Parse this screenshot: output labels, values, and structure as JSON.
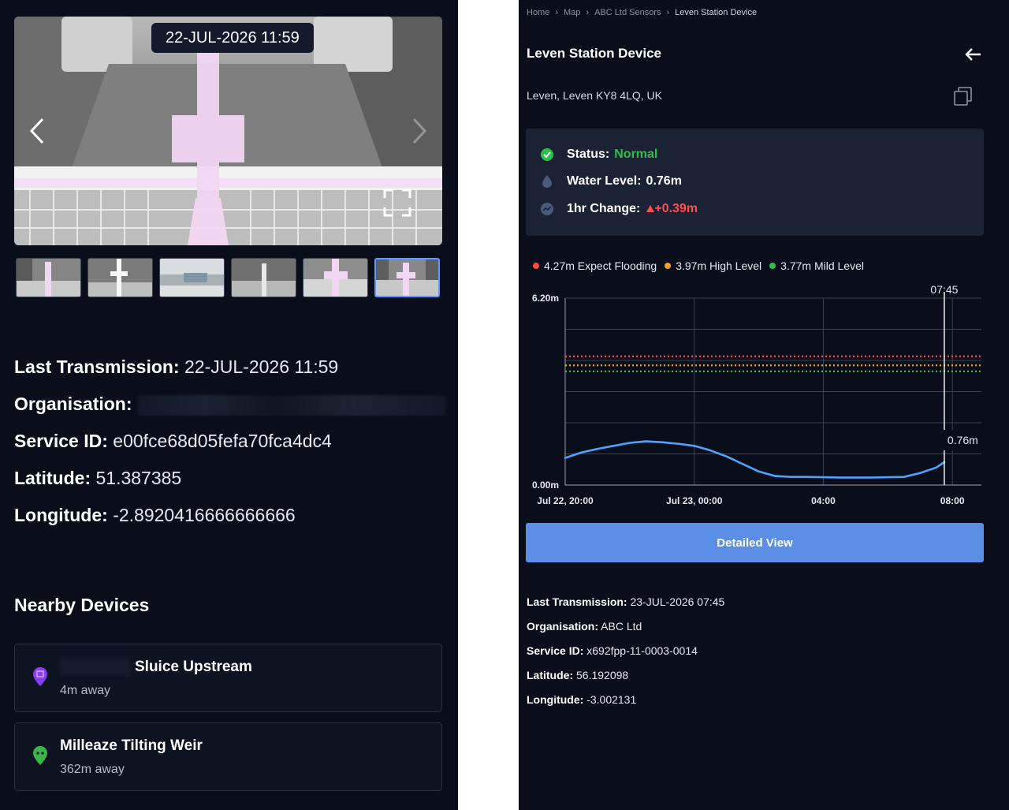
{
  "left": {
    "image_timestamp": "22-JUL-2026 11:59",
    "thumbnail_count": 6,
    "active_thumbnail": 6,
    "info": {
      "last_transmission_label": "Last Transmission:",
      "last_transmission_value": "22-JUL-2026 11:59",
      "organisation_label": "Organisation:",
      "service_id_label": "Service ID:",
      "service_id_value": "e00fce68d05fefa70fca4dc4",
      "latitude_label": "Latitude:",
      "latitude_value": "51.387385",
      "longitude_label": "Longitude:",
      "longitude_value": "-2.8920416666666666"
    },
    "nearby": {
      "title": "Nearby Devices",
      "devices": [
        {
          "name": "Sluice Upstream",
          "distance": "4m away",
          "pin_color": "#8a3cf0"
        },
        {
          "name": "Milleaze Tilting Weir",
          "distance": "362m away",
          "pin_color": "#39b54a"
        }
      ]
    }
  },
  "right": {
    "breadcrumb": [
      "Home",
      "Map",
      "ABC Ltd Sensors",
      "Leven Station Device"
    ],
    "title": "Leven Station Device",
    "address": "Leven, Leven KY8 4LQ, UK",
    "status": {
      "status_label": "Status:",
      "status_value": "Normal",
      "water_label": "Water Level:",
      "water_value": "0.76m",
      "change_label": "1hr Change:",
      "change_value": "+0.39m"
    },
    "legend": [
      {
        "label": "4.27m Expect Flooding",
        "color": "#ff4a4a"
      },
      {
        "label": "3.97m High Level",
        "color": "#f0a030"
      },
      {
        "label": "3.77m Mild Level",
        "color": "#2fbe4d"
      }
    ],
    "button_label": "Detailed View",
    "info": {
      "last_transmission_label": "Last Transmission:",
      "last_transmission_value": "23-JUL-2026 07:45",
      "organisation_label": "Organisation:",
      "organisation_value": "ABC Ltd",
      "service_id_label": "Service ID:",
      "service_id_value": "x692fpp-11-0003-0014",
      "latitude_label": "Latitude:",
      "latitude_value": "56.192098",
      "longitude_label": "Longitude:",
      "longitude_value": "-3.002131"
    }
  },
  "chart_data": {
    "type": "line",
    "ylim": [
      0,
      6.2
    ],
    "y_tick_labels": [
      "0.00m",
      "6.20m"
    ],
    "x_tick_labels": [
      "Jul 22, 20:00",
      "Jul 23, 00:00",
      "04:00",
      "08:00"
    ],
    "x_tick_hours": [
      0,
      4,
      8,
      12
    ],
    "cursor_label": "07:45",
    "cursor_hour": 11.75,
    "cursor_value_label": "0.76m",
    "thresholds": [
      {
        "value": 4.27,
        "color": "#ff4a4a"
      },
      {
        "value": 3.97,
        "color": "#f0a030"
      },
      {
        "value": 3.77,
        "color": "#2fbe4d"
      }
    ],
    "series": [
      {
        "color": "#4da3ff",
        "points": [
          [
            0,
            0.9
          ],
          [
            0.5,
            1.08
          ],
          [
            1,
            1.2
          ],
          [
            1.5,
            1.3
          ],
          [
            2,
            1.4
          ],
          [
            2.5,
            1.45
          ],
          [
            3,
            1.42
          ],
          [
            3.5,
            1.37
          ],
          [
            4,
            1.3
          ],
          [
            4.5,
            1.15
          ],
          [
            5,
            0.95
          ],
          [
            5.5,
            0.7
          ],
          [
            6,
            0.45
          ],
          [
            6.5,
            0.3
          ],
          [
            7,
            0.27
          ],
          [
            7.5,
            0.27
          ],
          [
            8,
            0.26
          ],
          [
            8.5,
            0.25
          ],
          [
            9,
            0.25
          ],
          [
            9.5,
            0.25
          ],
          [
            10,
            0.26
          ],
          [
            10.5,
            0.27
          ],
          [
            11,
            0.4
          ],
          [
            11.5,
            0.58
          ],
          [
            11.75,
            0.76
          ]
        ]
      }
    ]
  }
}
